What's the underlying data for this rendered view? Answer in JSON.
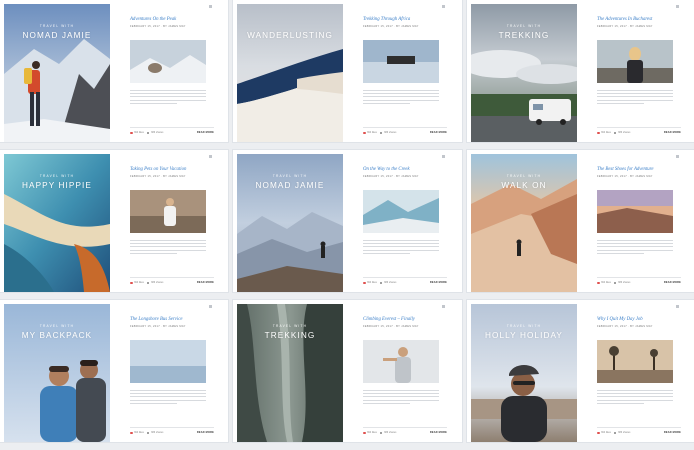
{
  "cards": [
    {
      "kicker": "TRAVEL WITH",
      "cover_title": "NOMAD JAMIE",
      "title": "Adventures On the Peak",
      "date": "FEBRUARY 15, 2017 · BY JAMES MAY",
      "likes": "364 likes",
      "comments": "386 shares",
      "read": "READ MORE"
    },
    {
      "kicker": "",
      "cover_title": "WANDERLUSTING",
      "title": "Trekking Through Africa",
      "date": "FEBRUARY 15, 2017 · BY JAMES MAY",
      "likes": "364 likes",
      "comments": "386 shares",
      "read": "READ MORE"
    },
    {
      "kicker": "TRAVEL WITH",
      "cover_title": "TREKKING",
      "title": "The Adventures In Bucharest",
      "date": "FEBRUARY 15, 2017 · BY JAMES MAY",
      "likes": "364 likes",
      "comments": "386 shares",
      "read": "READ MORE"
    },
    {
      "kicker": "TRAVEL WITH",
      "cover_title": "HAPPY HIPPIE",
      "title": "Taking Pets on Your Vacation",
      "date": "FEBRUARY 15, 2017 · BY JAMES MAY",
      "likes": "364 likes",
      "comments": "386 shares",
      "read": "READ MORE"
    },
    {
      "kicker": "TRAVEL WITH",
      "cover_title": "NOMAD JAMIE",
      "title": "On the Way to the Creek",
      "date": "FEBRUARY 15, 2017 · BY JAMES MAY",
      "likes": "364 likes",
      "comments": "386 shares",
      "read": "READ MORE"
    },
    {
      "kicker": "TRAVEL WITH",
      "cover_title": "WALK ON",
      "title": "The Best Shoes for Adventure",
      "date": "FEBRUARY 15, 2017 · BY JAMES MAY",
      "likes": "364 likes",
      "comments": "386 shares",
      "read": "READ MORE"
    },
    {
      "kicker": "TRAVEL WITH",
      "cover_title": "MY BACKPACK",
      "title": "The Longshore Bus Service",
      "date": "FEBRUARY 15, 2017 · BY JAMES MAY",
      "likes": "364 likes",
      "comments": "386 shares",
      "read": "READ MORE"
    },
    {
      "kicker": "TRAVEL WITH",
      "cover_title": "TREKKING",
      "title": "Climbing Everest – Finally",
      "date": "FEBRUARY 15, 2017 · BY JAMES MAY",
      "likes": "364 likes",
      "comments": "386 shares",
      "read": "READ MORE"
    },
    {
      "kicker": "TRAVEL WITH",
      "cover_title": "HOLLY HOLIDAY",
      "title": "Why I Quit My Day Job",
      "date": "FEBRUARY 15, 2017 · BY JAMES MAY",
      "likes": "364 likes",
      "comments": "386 shares",
      "read": "READ MORE"
    }
  ],
  "colors": {
    "accent": "#3b7fc8",
    "heart": "#e0504e"
  }
}
